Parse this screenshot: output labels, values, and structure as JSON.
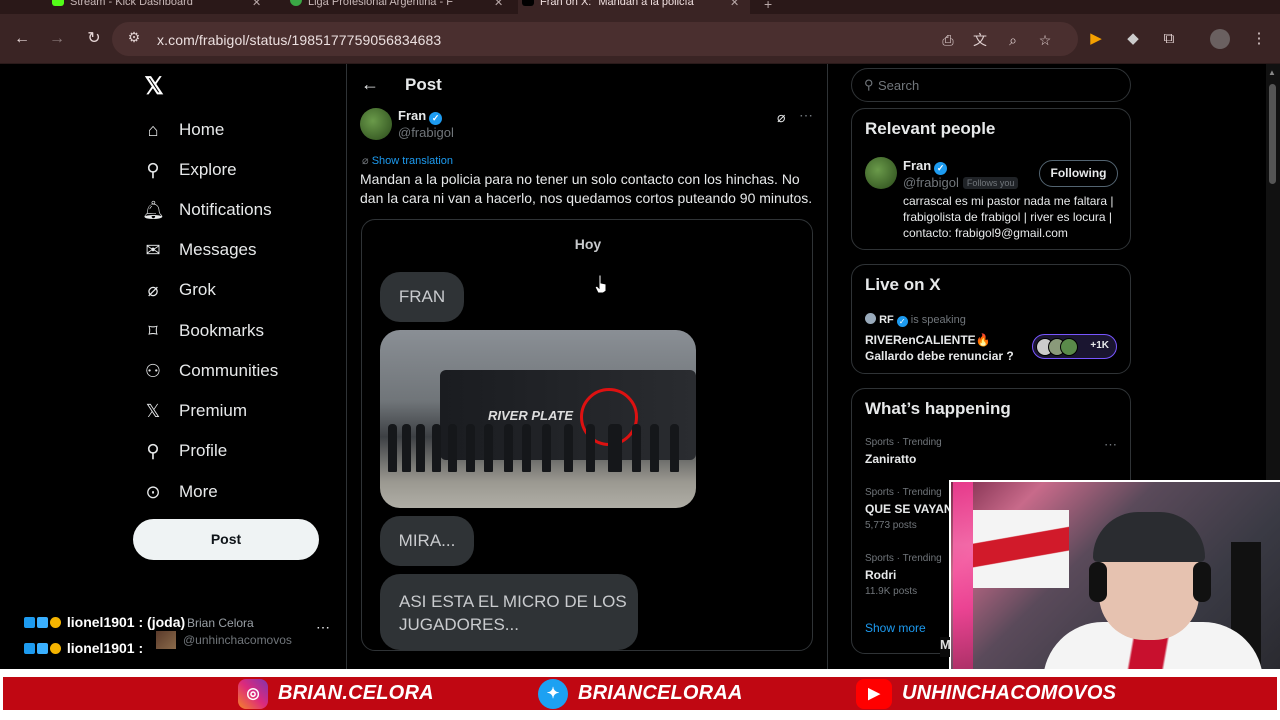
{
  "browser": {
    "tabs": [
      {
        "title": "Stream - Kick Dashboard",
        "active": false
      },
      {
        "title": "Liga Profesional Argentina - F",
        "active": false
      },
      {
        "title": "Fran on X: \"Mandan a la policía",
        "active": true
      }
    ],
    "url": "x.com/frabigol/status/1985177759056834683"
  },
  "sidebar": {
    "items": [
      {
        "label": "Home",
        "icon": "home-icon"
      },
      {
        "label": "Explore",
        "icon": "search-icon"
      },
      {
        "label": "Notifications",
        "icon": "bell-icon"
      },
      {
        "label": "Messages",
        "icon": "mail-icon"
      },
      {
        "label": "Grok",
        "icon": "grok-icon"
      },
      {
        "label": "Bookmarks",
        "icon": "bookmark-icon"
      },
      {
        "label": "Communities",
        "icon": "people-icon"
      },
      {
        "label": "Premium",
        "icon": "x-icon"
      },
      {
        "label": "Profile",
        "icon": "person-icon"
      },
      {
        "label": "More",
        "icon": "more-circle-icon"
      }
    ],
    "post_label": "Post",
    "account": {
      "name": "Brian Celora",
      "handle": "@unhinchacomovos",
      "chat": [
        {
          "user": "lionel1901",
          "message": "(joda)"
        },
        {
          "user": "lionel1901",
          "message": ""
        }
      ]
    }
  },
  "main": {
    "title": "Post",
    "tweet": {
      "name": "Fran",
      "handle": "@frabigol",
      "show_translation": "Show translation",
      "text": "Mandan a la policia para no tener un solo contacto con los hinchas. No dan la cara ni van a hacerlo, nos quedamos cortos puteando 90 minutos.",
      "chat": {
        "day": "Hoy",
        "bubbles": [
          "FRAN",
          "MIRA...",
          "ASI ESTA EL MICRO DE LOS JUGADORES..."
        ],
        "photo_bus_text": "RIVER PLATE"
      }
    }
  },
  "right": {
    "search_placeholder": "Search",
    "relevant": {
      "title": "Relevant people",
      "name": "Fran",
      "handle": "@frabigol",
      "follows_you": "Follows you",
      "following_label": "Following",
      "bio": "carrascal es mi pastor nada me faltara | frabigolista de frabigol | river es locura | contacto: frabigol9@gmail.com"
    },
    "live": {
      "title": "Live on X",
      "host": "RF",
      "status": "is speaking",
      "space_title": "RIVERenCALIENTE🔥 Gallardo debe renunciar ?",
      "count": "+1K"
    },
    "happening": {
      "title": "What’s happening",
      "trends": [
        {
          "category": "Sports · Trending",
          "name": "Zaniratto",
          "posts": ""
        },
        {
          "category": "Sports · Trending",
          "name": "QUE SE VAYAN",
          "posts": "5,773 posts"
        },
        {
          "category": "Sports · Trending",
          "name": "Rodri",
          "posts": "11.9K posts"
        }
      ],
      "show_more": "Show more"
    }
  },
  "overlay": {
    "webcam_letter": "M",
    "socials": [
      {
        "handle": "BRIAN.CELORA",
        "icon": "instagram-icon",
        "color": "#d62976"
      },
      {
        "handle": "BRIANCELORAA",
        "icon": "twitter-icon",
        "color": "#1da1f2"
      },
      {
        "handle": "UNHINCHACOMOVOS",
        "icon": "youtube-icon",
        "color": "#ff0000"
      }
    ]
  },
  "colors": {
    "accent": "#1d9bf0",
    "banner": "#c00712",
    "browser_chrome": "#3a2424"
  }
}
